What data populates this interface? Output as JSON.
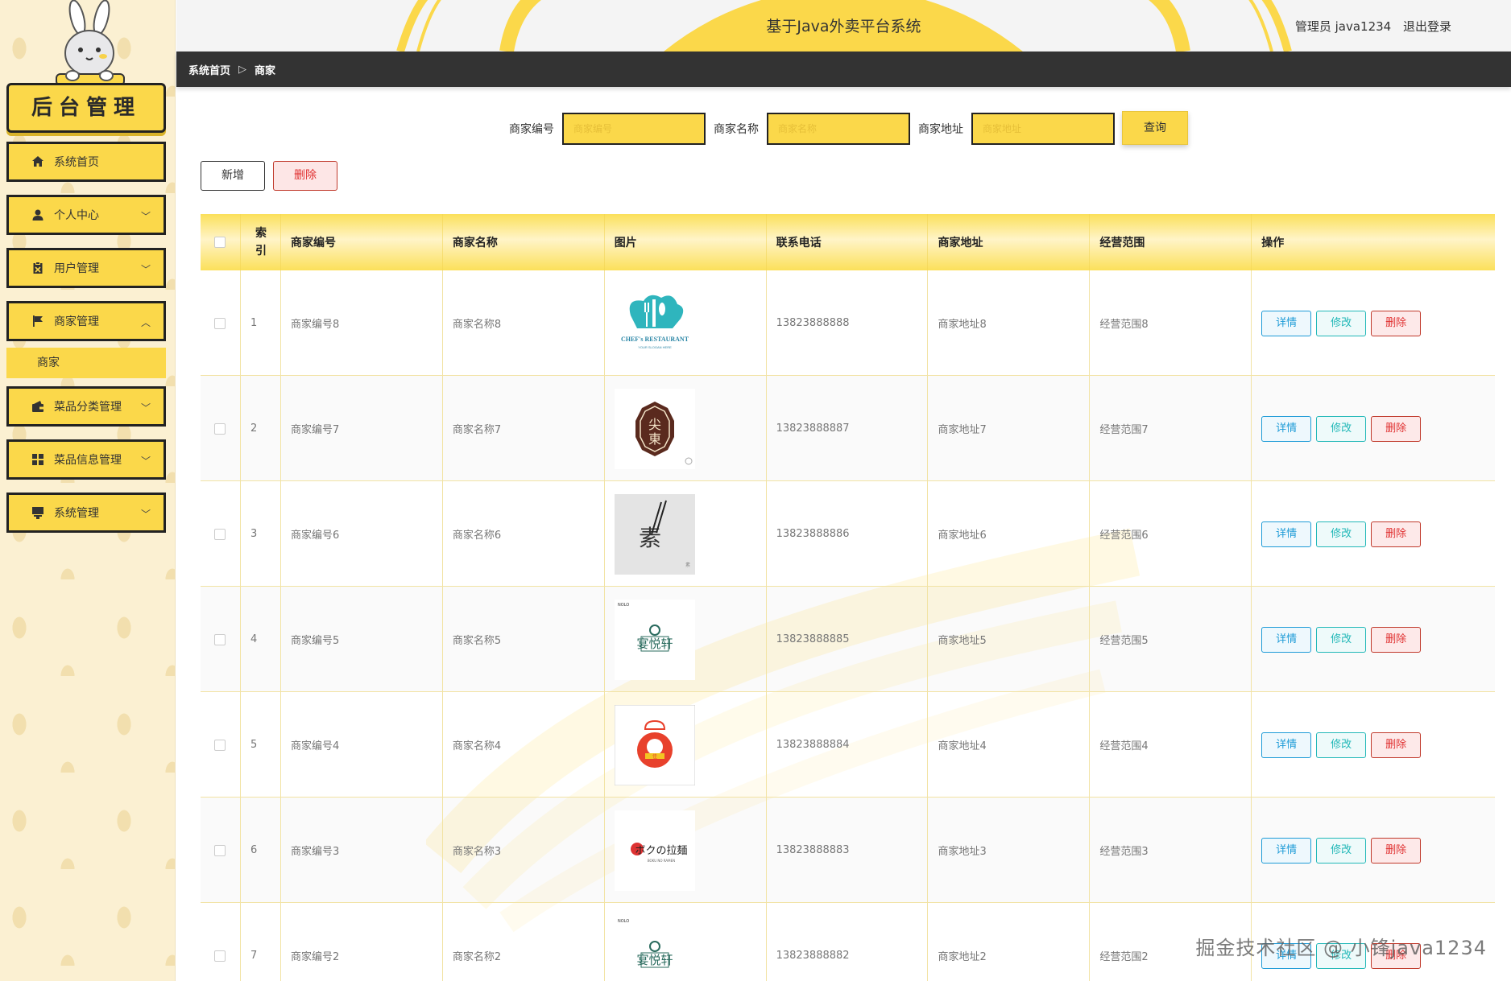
{
  "sidebar": {
    "brand": "后台管理",
    "menu": [
      {
        "label": "系统首页",
        "icon": "home-icon",
        "chevron": ""
      },
      {
        "label": "个人中心",
        "icon": "user-icon",
        "chevron": "﹀"
      },
      {
        "label": "用户管理",
        "icon": "clipboard-icon",
        "chevron": "﹀"
      },
      {
        "label": "商家管理",
        "icon": "flag-icon",
        "chevron": "︿"
      },
      {
        "label": "菜品分类管理",
        "icon": "wallet-icon",
        "chevron": "﹀"
      },
      {
        "label": "菜品信息管理",
        "icon": "grid-icon",
        "chevron": "﹀"
      },
      {
        "label": "系统管理",
        "icon": "system-icon",
        "chevron": "﹀"
      }
    ],
    "submenu_active": "商家"
  },
  "header": {
    "title": "基于Java外卖平台系统",
    "user": "管理员 java1234",
    "logout": "退出登录"
  },
  "breadcrumb": {
    "home": "系统首页",
    "separator": "▷",
    "current": "商家"
  },
  "search": {
    "code_label": "商家编号",
    "code_placeholder": "商家编号",
    "name_label": "商家名称",
    "name_placeholder": "商家名称",
    "addr_label": "商家地址",
    "addr_placeholder": "商家地址",
    "query_btn": "查询"
  },
  "actions": {
    "add": "新增",
    "delete": "删除"
  },
  "table": {
    "headers": {
      "index": "索引",
      "code": "商家编号",
      "name": "商家名称",
      "image": "图片",
      "phone": "联系电话",
      "addr": "商家地址",
      "scope": "经营范围",
      "ops": "操作"
    },
    "op_labels": {
      "detail": "详情",
      "edit": "修改",
      "delete": "删除"
    },
    "rows": [
      {
        "index": "1",
        "code": "商家编号8",
        "name": "商家名称8",
        "phone": "13823888888",
        "addr": "商家地址8",
        "scope": "经营范围8",
        "logo": "Chef's Restaurant"
      },
      {
        "index": "2",
        "code": "商家编号7",
        "name": "商家名称7",
        "phone": "13823888887",
        "addr": "商家地址7",
        "scope": "经营范围7",
        "logo": "尖东"
      },
      {
        "index": "3",
        "code": "商家编号6",
        "name": "商家名称6",
        "phone": "13823888886",
        "addr": "商家地址6",
        "scope": "经营范围6",
        "logo": "素"
      },
      {
        "index": "4",
        "code": "商家编号5",
        "name": "商家名称5",
        "phone": "13823888885",
        "addr": "商家地址5",
        "scope": "经营范围5",
        "logo": "宴悦轩"
      },
      {
        "index": "5",
        "code": "商家编号4",
        "name": "商家名称4",
        "phone": "13823888884",
        "addr": "商家地址4",
        "scope": "经营范围4",
        "logo": "chef-logo"
      },
      {
        "index": "6",
        "code": "商家编号3",
        "name": "商家名称3",
        "phone": "13823888883",
        "addr": "商家地址3",
        "scope": "经营范围3",
        "logo": "ボクの拉麺"
      },
      {
        "index": "7",
        "code": "商家编号2",
        "name": "商家名称2",
        "phone": "13823888882",
        "addr": "商家地址2",
        "scope": "经营范围2",
        "logo": "宴悦轩"
      }
    ]
  },
  "watermark": "掘金技术社区 @ 小锋java1234",
  "colors": {
    "accent": "#fbd84a",
    "dark": "#333333",
    "detail": "#1e9bd7",
    "edit": "#22b8b8",
    "danger": "#e03030"
  }
}
